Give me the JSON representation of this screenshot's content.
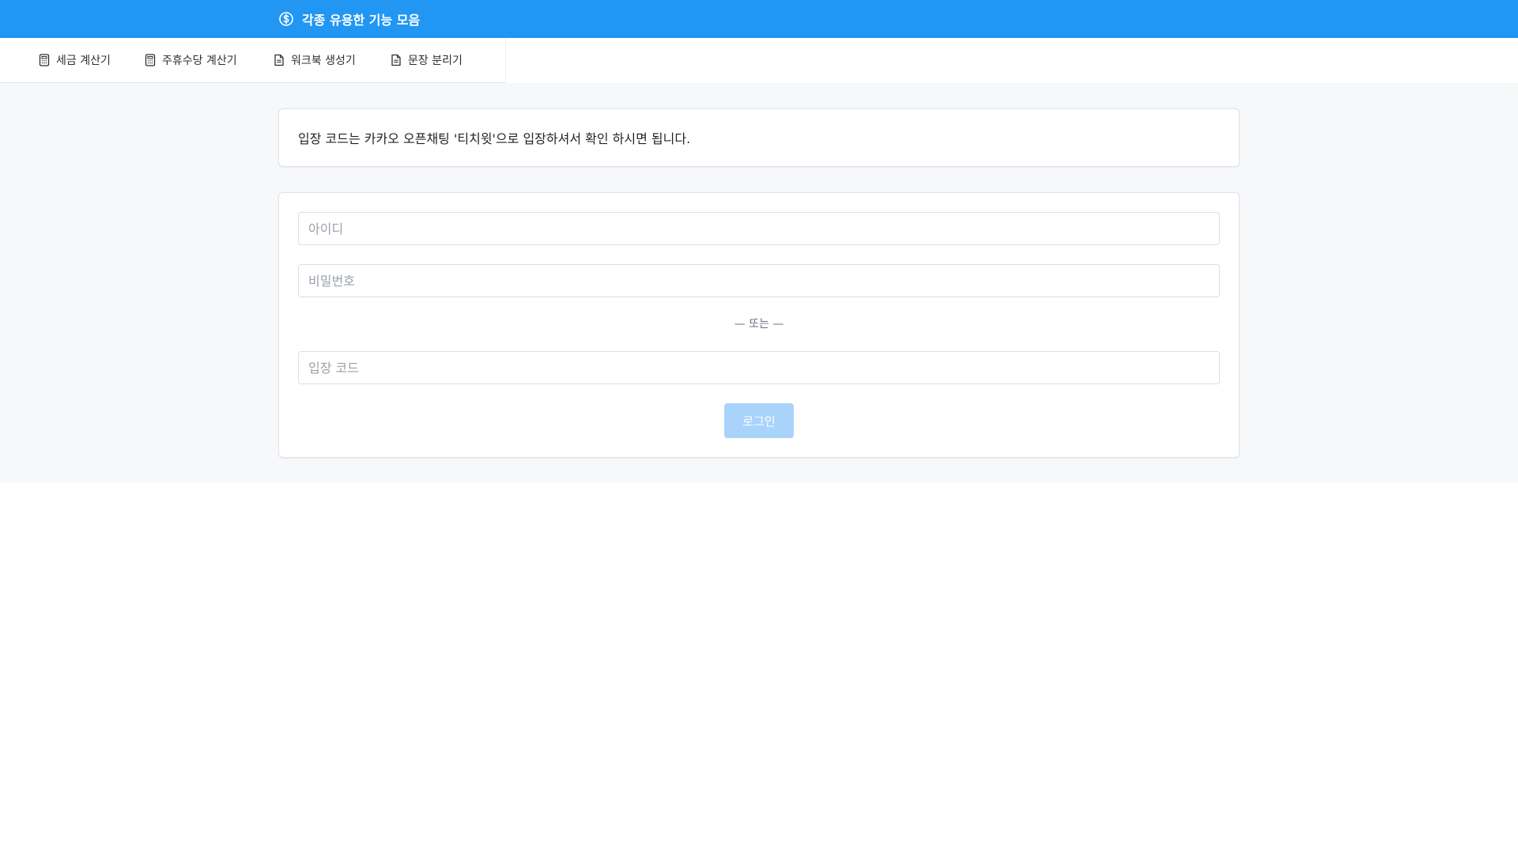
{
  "header": {
    "title": "각종 유용한 기능 모음",
    "icon": "dollar-circle-icon",
    "background": "#2196f3"
  },
  "nav": {
    "items": [
      {
        "label": "세금 계산기",
        "icon": "calculator-icon"
      },
      {
        "label": "주휴수당 계산기",
        "icon": "calculator-icon"
      },
      {
        "label": "워크북 생성기",
        "icon": "file-text-icon"
      },
      {
        "label": "문장 분리기",
        "icon": "file-text-icon"
      }
    ]
  },
  "notice": {
    "text": "입장 코드는 카카오 오픈채팅 '티치윗'으로 입장하셔서 확인 하시면 됩니다."
  },
  "login": {
    "id_placeholder": "아이디",
    "id_value": "",
    "password_placeholder": "비밀번호",
    "password_value": "",
    "divider": "— 또는 —",
    "code_placeholder": "입장 코드",
    "code_value": "",
    "button_label": "로그인",
    "button_color": "#a9d3fa"
  }
}
